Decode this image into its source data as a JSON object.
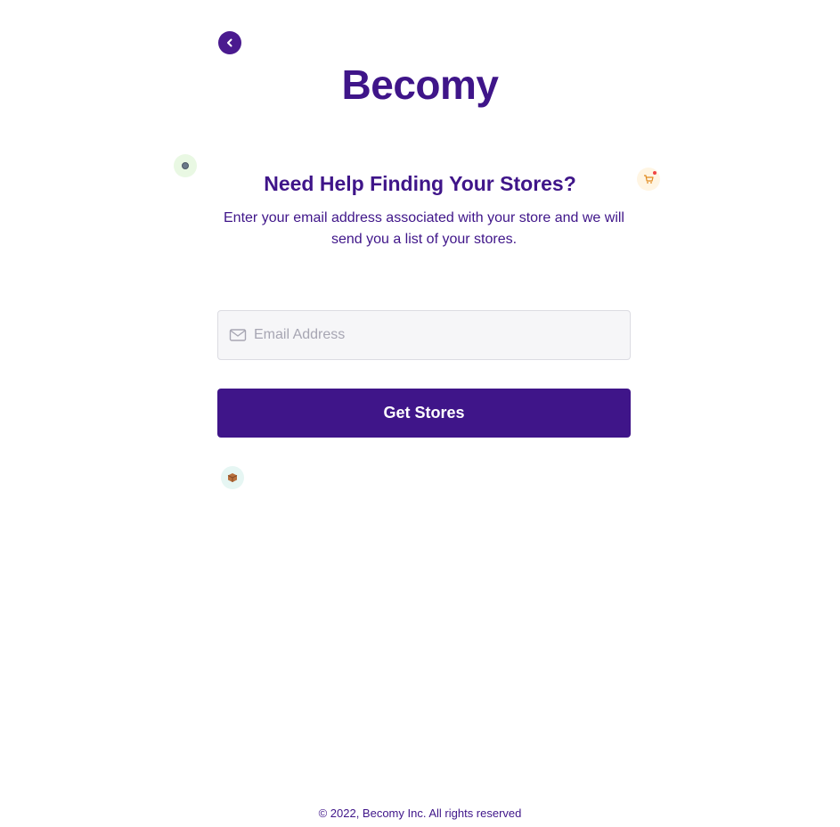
{
  "brand": {
    "name": "Becomy",
    "color": "#3f1589"
  },
  "nav": {
    "back_icon": "chevron-left-icon"
  },
  "content": {
    "heading": "Need Help Finding Your Stores?",
    "description": "Enter your email address associated with your store and we will send you a list of your stores."
  },
  "form": {
    "email_placeholder": "Email Address",
    "email_value": "",
    "email_icon": "mail-icon",
    "submit_label": "Get Stores"
  },
  "decorations": [
    "dot-icon",
    "shopping-cart-icon",
    "package-box-icon"
  ],
  "footer": {
    "copyright": "© 2022, Becomy Inc. All rights reserved"
  }
}
